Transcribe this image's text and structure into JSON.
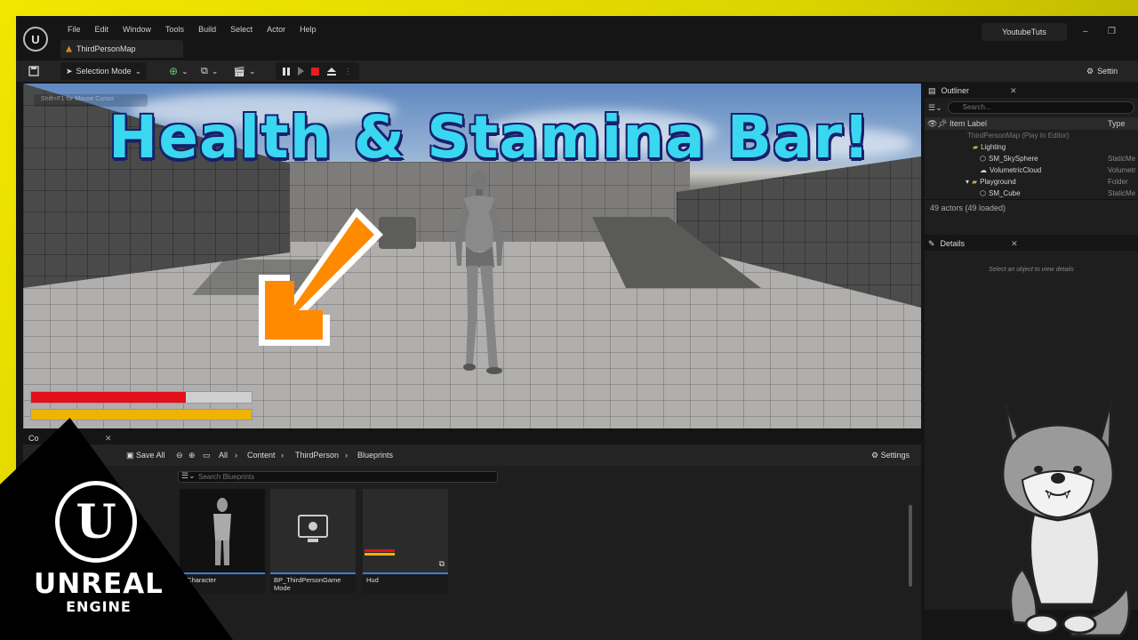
{
  "menu": [
    "File",
    "Edit",
    "Window",
    "Tools",
    "Build",
    "Select",
    "Actor",
    "Help"
  ],
  "map_tab": "ThirdPersonMap",
  "user_name": "YoutubeTuts",
  "toolbar": {
    "selection_mode": "Selection Mode",
    "settings": "Settin"
  },
  "viewport": {
    "hint": "Shift+F1 for Mouse Cursor",
    "headline": "Health & Stamina Bar!",
    "health_fraction": 0.7,
    "stamina_fraction": 1.0,
    "health_color": "#e3101b",
    "stamina_color": "#efb300"
  },
  "outliner": {
    "tab": "Outliner",
    "search_placeholder": "Search...",
    "col_label": "Item Label",
    "col_type": "Type",
    "rows": [
      {
        "name": "ThirdPersonMap (Play In Editor)",
        "type": ""
      },
      {
        "name": "Lighting",
        "type": ""
      },
      {
        "name": "SM_SkySphere",
        "type": "StaticMe"
      },
      {
        "name": "VolumetricCloud",
        "type": "Volumetr"
      },
      {
        "name": "Playground",
        "type": "Folder"
      },
      {
        "name": "SM_Cube",
        "type": "StaticMe"
      }
    ],
    "count": "49 actors (49 loaded)"
  },
  "details": {
    "tab": "Details",
    "empty": "Select an object to view details"
  },
  "content_browser": {
    "tab": "Co",
    "save_all": "Save All",
    "breadcrumb": [
      "All",
      "Content",
      "ThirdPerson",
      "Blueprints"
    ],
    "settings": "Settings",
    "search_placeholder": "Search Blueprints",
    "assets": [
      {
        "label": "nCharacter"
      },
      {
        "label": "BP_ThirdPersonGame Mode"
      },
      {
        "label": "Hud"
      }
    ]
  },
  "branding": {
    "word": "UNREAL",
    "sub": "ENGINE"
  }
}
